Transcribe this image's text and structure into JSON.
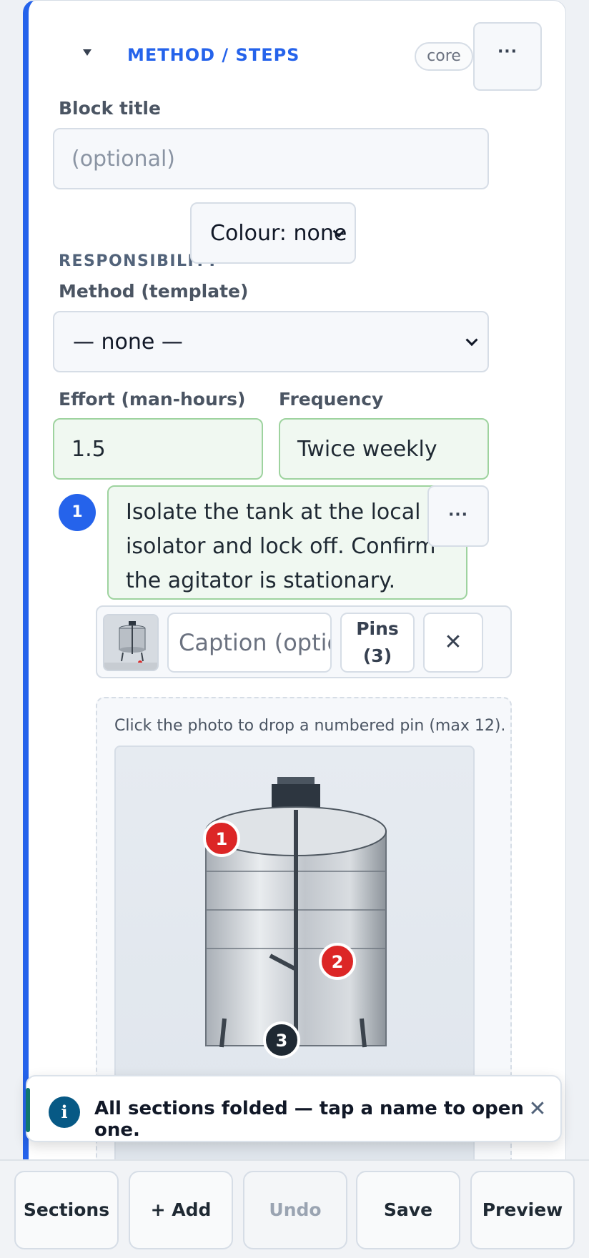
{
  "section": {
    "title": "METHOD / STEPS",
    "badge": "core",
    "more_label": "···"
  },
  "block_title": {
    "label": "Block title",
    "placeholder": "(optional)",
    "value": ""
  },
  "responsibility": {
    "label": "RESPONSIBILITY",
    "selected": "Colour: none"
  },
  "method_template": {
    "label": "Method (template)",
    "selected": "— none —"
  },
  "effort": {
    "label": "Effort (man-hours)",
    "value": "1.5"
  },
  "frequency": {
    "label": "Frequency",
    "value": "Twice weekly"
  },
  "step": {
    "number": "1",
    "text": "Isolate the tank at the local isolator and lock off. Confirm the agitator is stationary.",
    "more_label": "···",
    "photo": {
      "caption_placeholder": "Caption (optional)",
      "pins_label_line1": "Pins",
      "pins_label_line2": "(3)",
      "remove_label": "✕",
      "pin_hint": "Click the photo to drop a numbered pin (max 12).",
      "pins": [
        {
          "label": "1",
          "color": "#dc2626"
        },
        {
          "label": "2",
          "color": "#dc2626"
        },
        {
          "label": "3",
          "color": "#1f2933"
        }
      ]
    }
  },
  "toast": {
    "icon": "i",
    "message": "All sections folded — tap a name to open one.",
    "close": "✕"
  },
  "toolbar": {
    "sections": "Sections",
    "add": "+ Add",
    "undo": "Undo",
    "save": "Save",
    "preview": "Preview"
  },
  "colors": {
    "accent": "#2563eb",
    "pin": "#dc2626",
    "success_bg": "#f0f8f1"
  }
}
